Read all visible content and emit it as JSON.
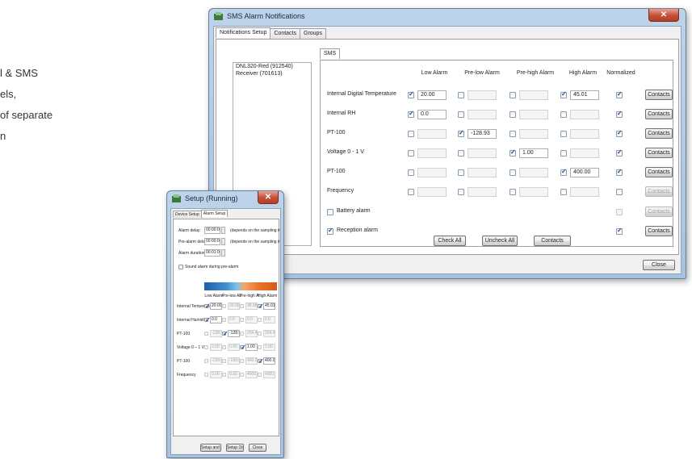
{
  "background_text": {
    "lines": [
      "l & SMS",
      "els,",
      "of separate",
      "n"
    ]
  },
  "sms_window": {
    "title": "SMS Alarm Notifications",
    "tabs": [
      "Notifications Setup",
      "Contacts",
      "Groups"
    ],
    "inner_tab": "SMS",
    "devices": [
      "DNL320-Red (912540)",
      "Receiver (701613)"
    ],
    "columns": [
      "Low Alarm",
      "Pre-low Alarm",
      "Pre-high Alarm",
      "High Alarm",
      "Normalized"
    ],
    "rows": [
      {
        "label": "Internal Digital Temperature",
        "cells": [
          {
            "checked": true,
            "value": "20.00"
          },
          {
            "checked": false,
            "value": ""
          },
          {
            "checked": false,
            "value": ""
          },
          {
            "checked": true,
            "value": "45.01"
          }
        ],
        "normalized": true,
        "button": "Contacts"
      },
      {
        "label": "Internal RH",
        "cells": [
          {
            "checked": true,
            "value": "0.0"
          },
          {
            "checked": false,
            "value": ""
          },
          {
            "checked": false,
            "value": ""
          },
          {
            "checked": false,
            "value": ""
          }
        ],
        "normalized": true,
        "button": "Contacts"
      },
      {
        "label": "PT-100",
        "cells": [
          {
            "checked": false,
            "value": ""
          },
          {
            "checked": true,
            "value": "-128.93"
          },
          {
            "checked": false,
            "value": ""
          },
          {
            "checked": false,
            "value": ""
          }
        ],
        "normalized": true,
        "button": "Contacts"
      },
      {
        "label": "Voltage 0 - 1 V",
        "cells": [
          {
            "checked": false,
            "value": ""
          },
          {
            "checked": false,
            "value": ""
          },
          {
            "checked": true,
            "value": "1.00"
          },
          {
            "checked": false,
            "value": ""
          }
        ],
        "normalized": true,
        "button": "Contacts"
      },
      {
        "label": "PT-100",
        "cells": [
          {
            "checked": false,
            "value": ""
          },
          {
            "checked": false,
            "value": ""
          },
          {
            "checked": false,
            "value": ""
          },
          {
            "checked": true,
            "value": "400.00"
          }
        ],
        "normalized": true,
        "button": "Contacts"
      },
      {
        "label": "Frequency",
        "cells": [
          {
            "checked": false,
            "value": ""
          },
          {
            "checked": false,
            "value": ""
          },
          {
            "checked": false,
            "value": ""
          },
          {
            "checked": false,
            "value": ""
          }
        ],
        "normalized": false,
        "button": "Contacts"
      }
    ],
    "battery_alarm": {
      "label": "Battery alarm",
      "checked": false,
      "normalized": false,
      "button": "Contacts"
    },
    "reception_alarm": {
      "label": "Reception alarm",
      "checked": true,
      "normalized": true,
      "button": "Contacts"
    },
    "check_all": "Check All",
    "uncheck_all": "Uncheck All",
    "contacts": "Contacts",
    "close": "Close"
  },
  "setup_window": {
    "title": "Setup (Running)",
    "tabs": [
      "Device Setup",
      "Alarm Setup"
    ],
    "alarm_delay": {
      "label": "Alarm delay:",
      "value": "00:00:00",
      "note": "(depends on the sampling interval)"
    },
    "prealarm_delay": {
      "label": "Pre-alarm delay:",
      "value": "00:00:00",
      "note": "(depends on the sampling interval)"
    },
    "alarm_duration": {
      "label": "Alarm duration:",
      "value": "00:01:00"
    },
    "sound_alarm": {
      "label": "Sound alarm during pre-alarm",
      "checked": false
    },
    "columns": [
      "Low Alarm",
      "Pre-low Alarm",
      "Pre-high Alarm",
      "High Alarm"
    ],
    "rows": [
      {
        "label": "Internal Temperature",
        "cells": [
          {
            "checked": true,
            "value": "20.00"
          },
          {
            "checked": false,
            "value": "20.00"
          },
          {
            "checked": false,
            "value": "38.98"
          },
          {
            "checked": true,
            "value": "45.01"
          }
        ]
      },
      {
        "label": "Internal Humidity",
        "cells": [
          {
            "checked": true,
            "value": "0.0"
          },
          {
            "checked": false,
            "value": "0.0"
          },
          {
            "checked": false,
            "value": "0.0"
          },
          {
            "checked": false,
            "value": "0.0"
          }
        ]
      },
      {
        "label": "PT-100",
        "cells": [
          {
            "checked": false,
            "value": "-128.93"
          },
          {
            "checked": true,
            "value": "-128.93"
          },
          {
            "checked": false,
            "value": "204.41"
          },
          {
            "checked": false,
            "value": "204.41"
          }
        ]
      },
      {
        "label": "Voltage 0 – 1 V",
        "cells": [
          {
            "checked": false,
            "value": "0.00"
          },
          {
            "checked": false,
            "value": "0.00"
          },
          {
            "checked": true,
            "value": "1.00"
          },
          {
            "checked": false,
            "value": "1.00"
          }
        ]
      },
      {
        "label": "PT-100",
        "cells": [
          {
            "checked": false,
            "value": "-199.01"
          },
          {
            "checked": false,
            "value": "-199.01"
          },
          {
            "checked": false,
            "value": "400.00"
          },
          {
            "checked": true,
            "value": "400.00"
          }
        ]
      },
      {
        "label": "Frequency",
        "cells": [
          {
            "checked": false,
            "value": "0.00"
          },
          {
            "checked": false,
            "value": "0.00"
          },
          {
            "checked": false,
            "value": "4000.00"
          },
          {
            "checked": false,
            "value": "4000.00"
          }
        ]
      }
    ],
    "setup_and_run": "Setup and Run",
    "setup_only": "Setup Only",
    "close": "Close"
  }
}
